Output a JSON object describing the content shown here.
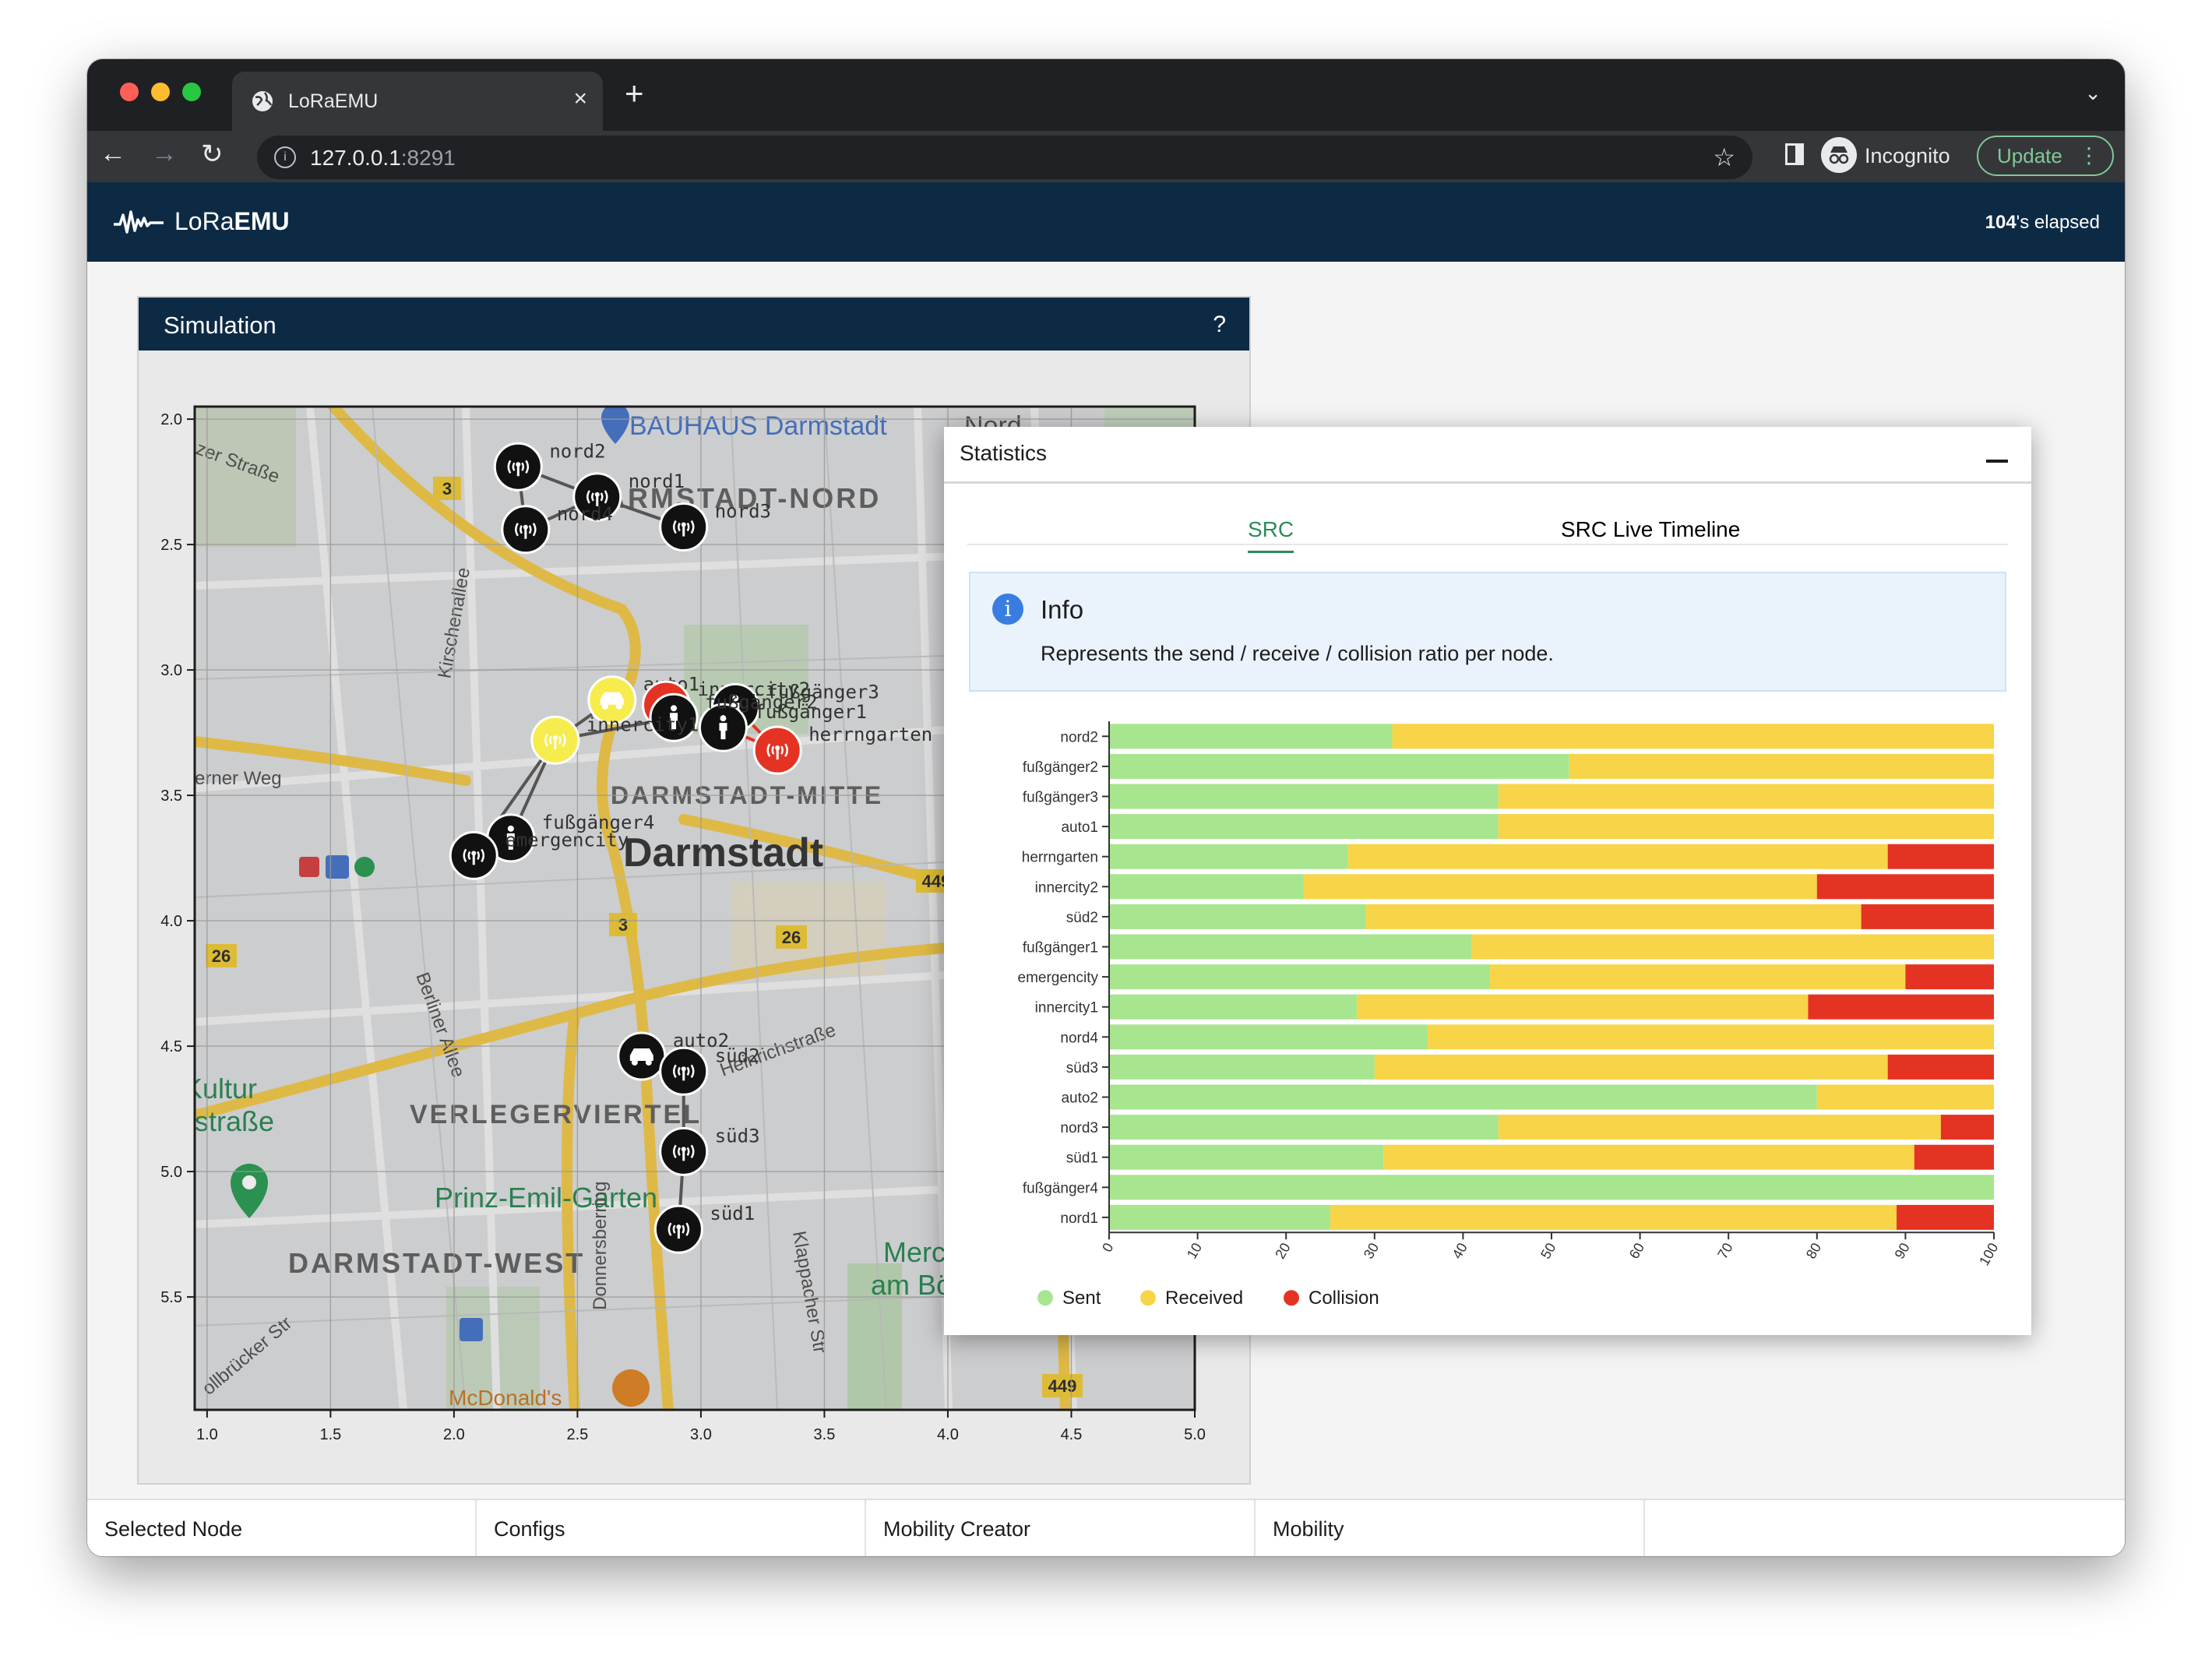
{
  "browser": {
    "tab_title": "LoRaEMU",
    "url_host": "127.0.0.1",
    "url_port": ":8291",
    "profile_label": "Incognito",
    "update_label": "Update",
    "colors": {
      "frame": "#1f2023",
      "toolbar": "#35363a",
      "update": "#81c995"
    }
  },
  "app": {
    "logo_prefix": "LoRa",
    "logo_bold": "EMU",
    "elapsed_value": "104",
    "elapsed_suffix": "'s elapsed",
    "colors": {
      "header": "#0d2a45"
    }
  },
  "simulation": {
    "title": "Simulation",
    "help": "?",
    "map_labels": [
      "BAUHAUS Darmstadt",
      "Nord",
      "DARMSTADT-NORD",
      "DARMSTADT-MITTE",
      "Darmstadt",
      "VERLEGERVIERTEL",
      "Prinz-Emil-Garten",
      "DARMSTADT-WEST",
      "Kultur",
      "straße",
      "Merck",
      "am Bö",
      "Kirschenallee",
      "Berliner Allee",
      "Donnersberring",
      "Klappacher Str",
      "Heinrichstraße",
      "erner Weg",
      "zer Straße",
      "McDonald's",
      "ollbrücker Str"
    ],
    "road_badges": [
      "3",
      "26",
      "3",
      "26",
      "449",
      "449"
    ],
    "x_ticks": [
      "1.0",
      "1.5",
      "2.0",
      "2.5",
      "3.0",
      "3.5",
      "4.0",
      "4.5",
      "5.0"
    ],
    "y_ticks": [
      "2.0",
      "2.5",
      "3.0",
      "3.5",
      "4.0",
      "4.5",
      "5.0",
      "5.5"
    ],
    "nodes": [
      {
        "name": "nord2",
        "type": "gateway",
        "state": "idle",
        "x": 2.26,
        "y": 2.19
      },
      {
        "name": "nord1",
        "type": "gateway",
        "state": "idle",
        "x": 2.58,
        "y": 2.31
      },
      {
        "name": "nord4",
        "type": "gateway",
        "state": "idle",
        "x": 2.29,
        "y": 2.44
      },
      {
        "name": "nord3",
        "type": "gateway",
        "state": "idle",
        "x": 2.93,
        "y": 2.43
      },
      {
        "name": "auto1",
        "type": "car",
        "state": "receiving",
        "x": 2.64,
        "y": 3.12
      },
      {
        "name": "innercity2",
        "type": "gateway",
        "state": "collision",
        "x": 2.86,
        "y": 3.14
      },
      {
        "name": "fußgänger3",
        "type": "pedestrian",
        "state": "idle",
        "x": 3.14,
        "y": 3.15
      },
      {
        "name": "fußgänger1",
        "type": "pedestrian",
        "state": "idle",
        "x": 3.09,
        "y": 3.23
      },
      {
        "name": "fußgänger2",
        "type": "pedestrian",
        "state": "idle",
        "x": 2.89,
        "y": 3.19
      },
      {
        "name": "innercity1",
        "type": "gateway",
        "state": "receiving",
        "x": 2.41,
        "y": 3.28
      },
      {
        "name": "herrngarten",
        "type": "gateway",
        "state": "collision",
        "x": 3.31,
        "y": 3.32
      },
      {
        "name": "fußgänger4",
        "type": "pedestrian",
        "state": "idle",
        "x": 2.23,
        "y": 3.67
      },
      {
        "name": "emergencity",
        "type": "gateway",
        "state": "idle",
        "x": 2.08,
        "y": 3.74
      },
      {
        "name": "auto2",
        "type": "car",
        "state": "idle",
        "x": 2.76,
        "y": 4.54
      },
      {
        "name": "süd2",
        "type": "gateway",
        "state": "idle",
        "x": 2.93,
        "y": 4.6
      },
      {
        "name": "süd3",
        "type": "gateway",
        "state": "idle",
        "x": 2.93,
        "y": 4.92
      },
      {
        "name": "süd1",
        "type": "gateway",
        "state": "idle",
        "x": 2.91,
        "y": 5.23
      }
    ],
    "node_colors": {
      "idle": "#111111",
      "receiving": "#f7ec4d",
      "collision": "#e53323"
    }
  },
  "statistics": {
    "title": "Statistics",
    "tabs": [
      "SRC",
      "SRC Live Timeline"
    ],
    "active_tab": "SRC",
    "info_title": "Info",
    "info_icon": "info-icon",
    "info_text": "Represents the send / receive / collision ratio per node.",
    "legend": [
      {
        "label": "Sent",
        "color": "#a8e58f"
      },
      {
        "label": "Received",
        "color": "#f8d448"
      },
      {
        "label": "Collision",
        "color": "#e53323"
      }
    ]
  },
  "chart_data": {
    "type": "bar",
    "orientation": "horizontal",
    "stacked": true,
    "categories": [
      "nord2",
      "fußgänger2",
      "fußgänger3",
      "auto1",
      "herrngarten",
      "innercity2",
      "süd2",
      "fußgänger1",
      "emergencity",
      "innercity1",
      "nord4",
      "süd3",
      "auto2",
      "nord3",
      "süd1",
      "fußgänger4",
      "nord1"
    ],
    "series": [
      {
        "name": "Sent",
        "values": [
          32,
          52,
          44,
          44,
          27,
          22,
          29,
          41,
          43,
          28,
          36,
          30,
          80,
          44,
          31,
          100,
          25
        ]
      },
      {
        "name": "Received",
        "values": [
          68,
          48,
          56,
          56,
          61,
          58,
          56,
          59,
          47,
          51,
          64,
          58,
          20,
          50,
          60,
          0,
          64
        ]
      },
      {
        "name": "Collision",
        "values": [
          0,
          0,
          0,
          0,
          12,
          20,
          15,
          0,
          10,
          21,
          0,
          12,
          0,
          6,
          9,
          0,
          11
        ]
      }
    ],
    "xlim": [
      0,
      100
    ],
    "x_ticks": [
      "0",
      "10",
      "20",
      "30",
      "40",
      "50",
      "60",
      "70",
      "80",
      "90",
      "100"
    ],
    "legend_position": "bottom-left",
    "grid": false
  },
  "bottom_tabs": [
    "Selected Node",
    "Configs",
    "Mobility Creator",
    "Mobility"
  ]
}
